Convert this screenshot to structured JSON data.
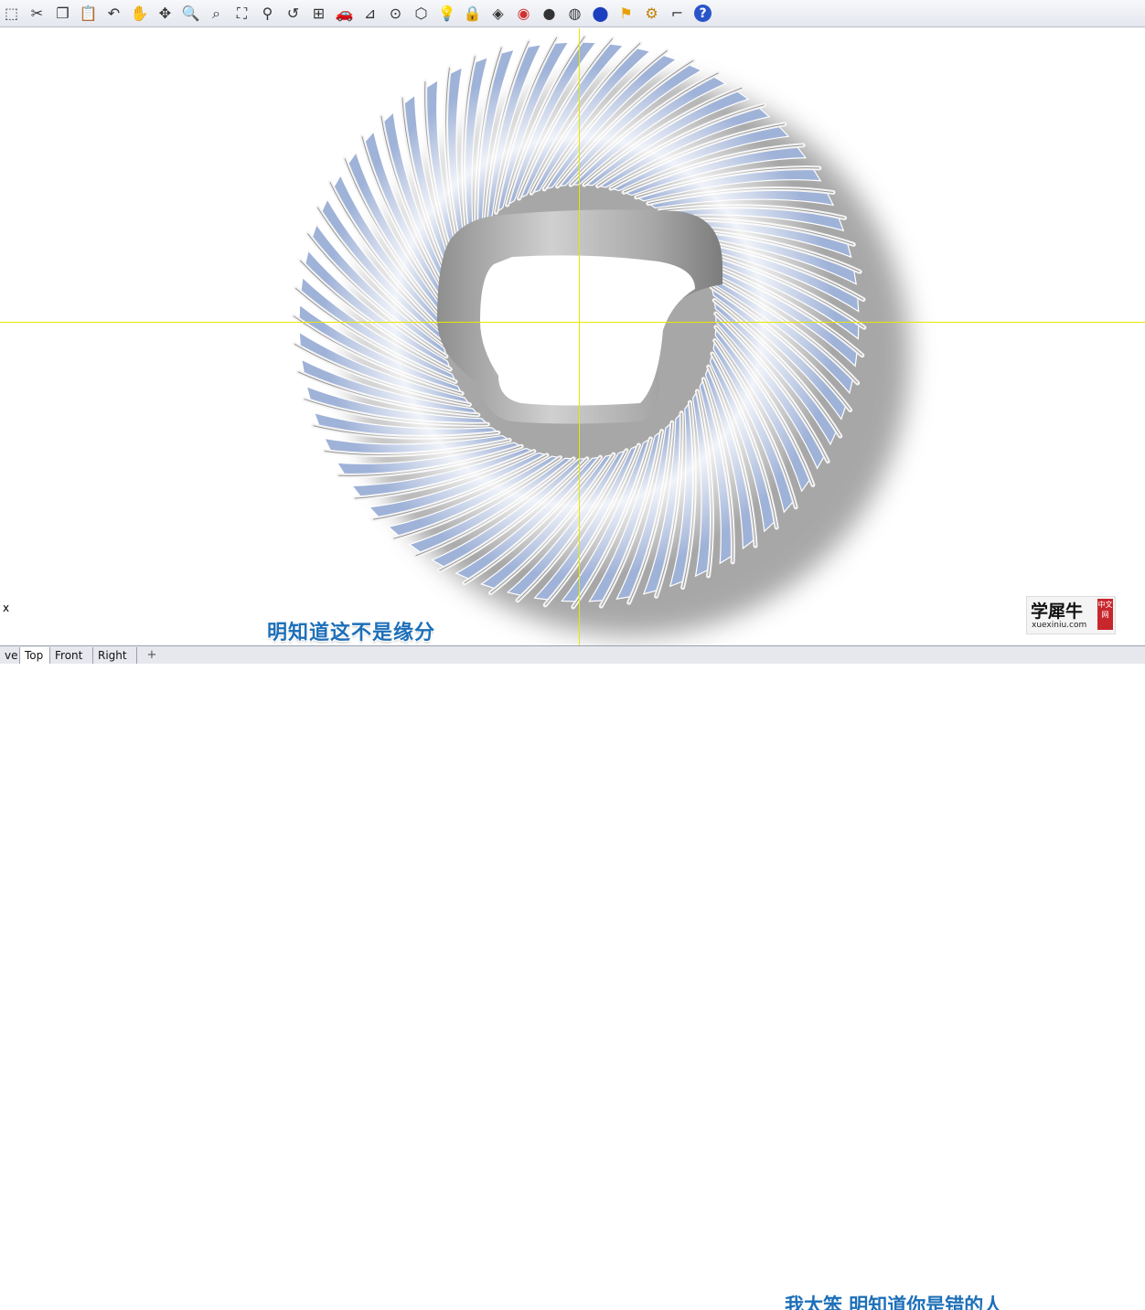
{
  "toolbar": {
    "icons": [
      {
        "name": "new-document-icon",
        "glyph": "⬚"
      },
      {
        "name": "cut-icon",
        "glyph": "✂"
      },
      {
        "name": "copy-icon",
        "glyph": "❐"
      },
      {
        "name": "paste-icon",
        "glyph": "📋"
      },
      {
        "name": "undo-icon",
        "glyph": "↶"
      },
      {
        "name": "pan-hand-icon",
        "glyph": "✋"
      },
      {
        "name": "rotate-view-icon",
        "glyph": "✥"
      },
      {
        "name": "zoom-dynamic-icon",
        "glyph": "🔍"
      },
      {
        "name": "zoom-window-icon",
        "glyph": "⌕"
      },
      {
        "name": "zoom-extents-icon",
        "glyph": "⛶"
      },
      {
        "name": "zoom-selected-icon",
        "glyph": "⚲"
      },
      {
        "name": "undo-view-icon",
        "glyph": "↺"
      },
      {
        "name": "four-viewports-icon",
        "glyph": "⊞"
      },
      {
        "name": "car-render-icon",
        "glyph": "🚗"
      },
      {
        "name": "properties-icon",
        "glyph": "⊿"
      },
      {
        "name": "grid-snap-icon",
        "glyph": "⊙"
      },
      {
        "name": "osnap-icon",
        "glyph": "⬡"
      },
      {
        "name": "light-bulb-icon",
        "glyph": "💡"
      },
      {
        "name": "lock-icon",
        "glyph": "🔒"
      },
      {
        "name": "layer-icon",
        "glyph": "◈"
      },
      {
        "name": "color-wheel-icon",
        "glyph": "◉"
      },
      {
        "name": "shaded-sphere-icon",
        "glyph": "●"
      },
      {
        "name": "rendered-sphere-icon",
        "glyph": "◍"
      },
      {
        "name": "blue-sphere-icon",
        "glyph": "⬤"
      },
      {
        "name": "flag-icon",
        "glyph": "⚑"
      },
      {
        "name": "settings-gear-icon",
        "glyph": "⚙"
      },
      {
        "name": "dimension-icon",
        "glyph": "⌐"
      },
      {
        "name": "help-icon",
        "glyph": "?"
      }
    ]
  },
  "colors": {
    "axis": "#e8e800",
    "subtitle": "#1d6fb8",
    "fin_blue": "#9fb2d8",
    "fin_light": "#e9eef8",
    "shadow": "#8a8a8a",
    "seal_red": "#c8262d"
  },
  "viewport": {
    "axis_label": "x"
  },
  "subtitle": {
    "main": "明知道这不是缘分",
    "secondary": "我太笨 明知道你是错的人"
  },
  "logo": {
    "cn": "学犀牛",
    "en": "xuexiniu.com",
    "seal": "中文网"
  },
  "tabs": {
    "items": [
      {
        "label": "ve"
      },
      {
        "label": "Top"
      },
      {
        "label": "Front"
      },
      {
        "label": "Right"
      }
    ],
    "add_symbol": "+"
  }
}
